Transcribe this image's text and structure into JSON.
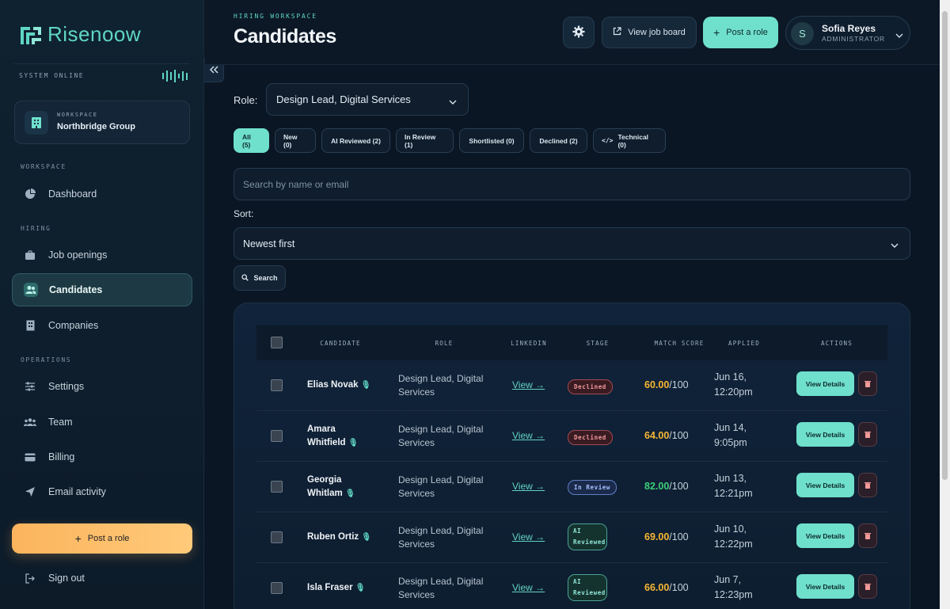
{
  "app": {
    "logo_text": "Risenoow",
    "system_status": "SYSTEM ONLINE",
    "accent_color": "#6fe0cc",
    "warning_color": "#fbb45d"
  },
  "sidebar": {
    "workspace_label": "WORKSPACE",
    "workspace_name": "Northbridge Group",
    "sections": {
      "workspace": "WORKSPACE",
      "hiring": "HIRING",
      "operations": "OPERATIONS"
    },
    "items": [
      {
        "label": "Dashboard",
        "icon": "pie-chart-icon"
      },
      {
        "label": "Job openings",
        "icon": "briefcase-icon"
      },
      {
        "label": "Candidates",
        "icon": "users-icon",
        "active": true
      },
      {
        "label": "Companies",
        "icon": "building-icon"
      },
      {
        "label": "Settings",
        "icon": "sliders-icon"
      },
      {
        "label": "Team",
        "icon": "team-icon"
      },
      {
        "label": "Billing",
        "icon": "credit-card-icon"
      },
      {
        "label": "Email activity",
        "icon": "send-icon"
      }
    ],
    "post_role": "Post a role",
    "sign_out": "Sign out"
  },
  "header": {
    "eyebrow": "HIRING WORKSPACE",
    "title": "Candidates",
    "view_job_board": "View job board",
    "post_role": "Post a role",
    "user_initial": "S",
    "user_name": "Sofia Reyes",
    "user_role": "ADMINISTRATOR"
  },
  "filters": {
    "role_label": "Role:",
    "role_value": "Design Lead, Digital Services",
    "chips": [
      "All (5)",
      "New (0)",
      "AI Reviewed (2)",
      "In Review (1)",
      "Shortlisted (0)",
      "Declined (2)",
      "Technical (0)"
    ],
    "search_placeholder": "Search by name or email",
    "sort_label": "Sort:",
    "sort_value": "Newest first",
    "search_button": "Search"
  },
  "table": {
    "columns": [
      "CANDIDATE",
      "ROLE",
      "LINKEDIN",
      "STAGE",
      "MATCH SCORE",
      "APPLIED",
      "ACTIONS"
    ],
    "rows": [
      {
        "name": "Elias Novak",
        "role": "Design Lead, Digital Services",
        "link": "View →",
        "stage": "Declined",
        "score": "60.00",
        "score_suffix": "/100",
        "applied": "Jun 16, 12:20pm",
        "action": "View Details"
      },
      {
        "name": "Amara Whitfield",
        "role": "Design Lead, Digital Services",
        "link": "View →",
        "stage": "Declined",
        "score": "64.00",
        "score_suffix": "/100",
        "applied": "Jun 14, 9:05pm",
        "action": "View Details"
      },
      {
        "name": "Georgia Whitlam",
        "role": "Design Lead, Digital Services",
        "link": "View →",
        "stage": "In Review",
        "score": "82.00",
        "score_suffix": "/100",
        "applied": "Jun 13, 12:21pm",
        "action": "View Details"
      },
      {
        "name": "Ruben Ortiz",
        "role": "Design Lead, Digital Services",
        "link": "View →",
        "stage": "AI Reviewed",
        "score": "69.00",
        "score_suffix": "/100",
        "applied": "Jun 10, 12:22pm",
        "action": "View Details"
      },
      {
        "name": "Isla Fraser",
        "role": "Design Lead, Digital Services",
        "link": "View →",
        "stage": "AI Reviewed",
        "score": "66.00",
        "score_suffix": "/100",
        "applied": "Jun 7, 12:23pm",
        "action": "View Details"
      }
    ]
  }
}
